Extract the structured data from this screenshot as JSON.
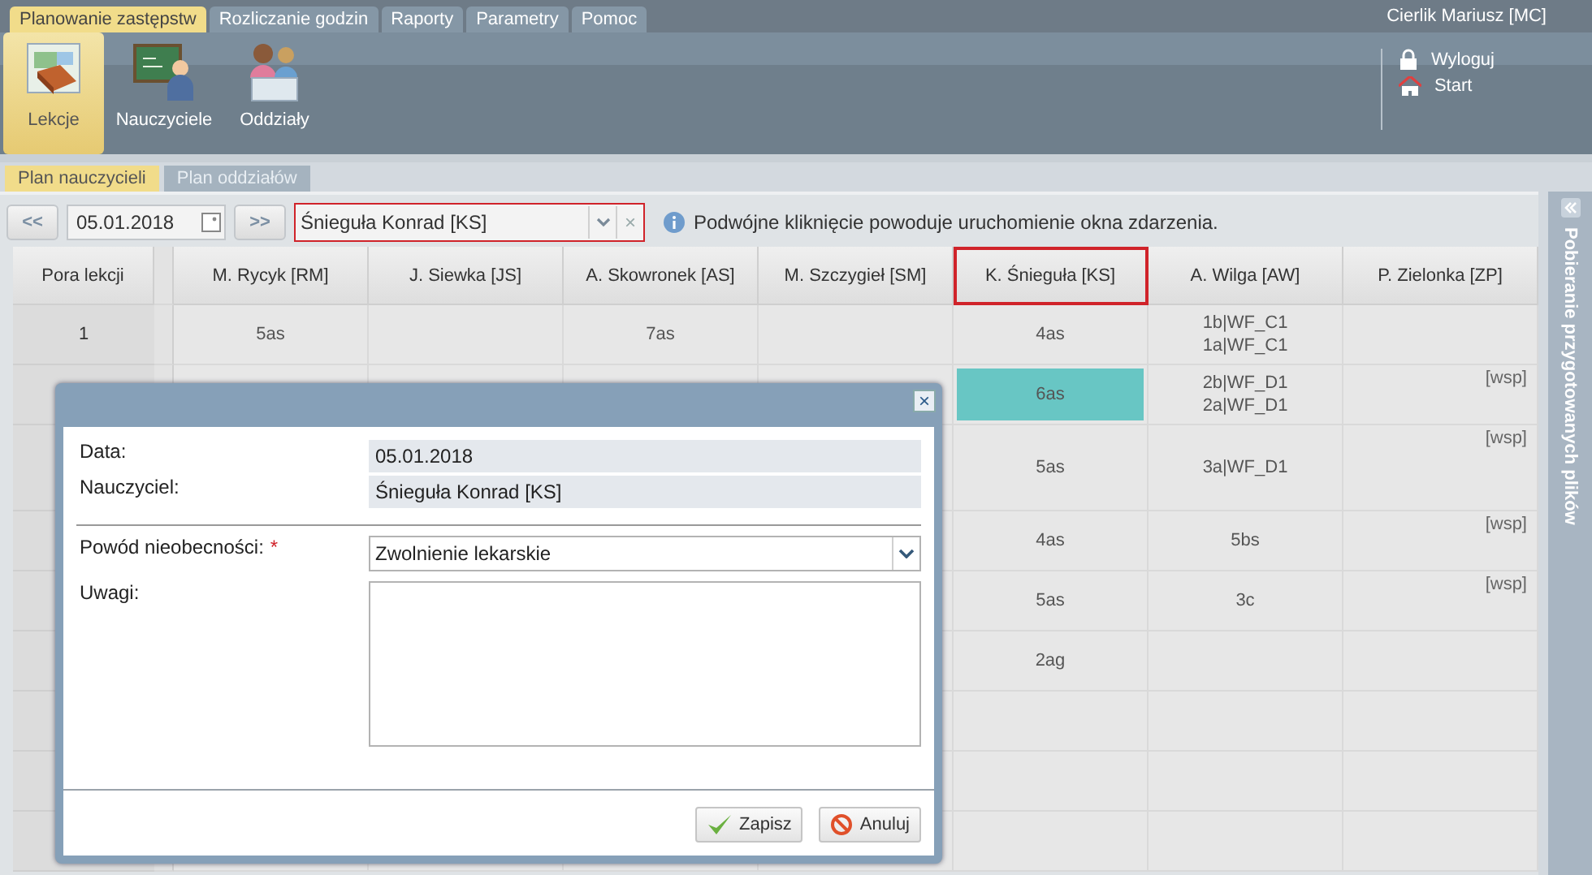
{
  "menu_tabs": [
    {
      "label": "Planowanie zastępstw",
      "selected": true
    },
    {
      "label": "Rozliczanie godzin",
      "selected": false
    },
    {
      "label": "Raporty",
      "selected": false
    },
    {
      "label": "Parametry",
      "selected": false
    },
    {
      "label": "Pomoc",
      "selected": false
    }
  ],
  "user": "Cierlik Mariusz [MC]",
  "ribbon": [
    {
      "label": "Lekcje",
      "kind": "lessons",
      "selected": true
    },
    {
      "label": "Nauczyciele",
      "kind": "teachers",
      "selected": false
    },
    {
      "label": "Oddziały",
      "kind": "classes",
      "selected": false
    }
  ],
  "user_links": [
    {
      "label": "Wyloguj",
      "kind": "logout"
    },
    {
      "label": "Start",
      "kind": "home"
    }
  ],
  "view_tabs": [
    {
      "label": "Plan nauczycieli",
      "selected": true
    },
    {
      "label": "Plan oddziałów",
      "selected": false
    }
  ],
  "toolbar": {
    "prev": "<<",
    "date": "05.01.2018",
    "next": ">>",
    "teacher": "Śnieguła Konrad [KS]",
    "teacher_highlighted": true,
    "clear": "×",
    "hint": "Podwójne kliknięcie powoduje uruchomienie okna zdarzenia."
  },
  "side_panel": {
    "title": "Pobieranie przygotowanych plików"
  },
  "table": {
    "period_header": "Pora lekcji",
    "columns": [
      {
        "label": "M. Rycyk [RM]",
        "selected": false
      },
      {
        "label": "J. Siewka [JS]",
        "selected": false
      },
      {
        "label": "A. Skowronek [AS]",
        "selected": false
      },
      {
        "label": "M. Szczygieł [SM]",
        "selected": false
      },
      {
        "label": "K. Śnieguła [KS]",
        "selected": true
      },
      {
        "label": "A. Wilga [AW]",
        "selected": false
      },
      {
        "label": "P. Zielonka [ZP]",
        "selected": false
      }
    ],
    "rows": [
      {
        "period": "1",
        "cells": [
          {
            "lines": [
              "5as"
            ]
          },
          null,
          {
            "lines": [
              "7as"
            ]
          },
          null,
          {
            "lines": [
              "4as"
            ],
            "selected": false
          },
          {
            "lines": [
              "1b|WF_C1",
              "1a|WF_C1"
            ]
          },
          null
        ]
      },
      {
        "cells": [
          null,
          null,
          null,
          null,
          {
            "lines": [
              "6as"
            ],
            "selected": true
          },
          {
            "lines": [
              "2b|WF_D1",
              "2a|WF_D1"
            ]
          },
          {
            "tag": "[wsp]"
          }
        ]
      },
      {
        "cells": [
          null,
          null,
          null,
          null,
          {
            "lines": [
              "5as"
            ],
            "selected": false
          },
          {
            "lines": [
              "3a|WF_D1"
            ]
          },
          {
            "tag": "[wsp]"
          }
        ],
        "tall": true
      },
      {
        "cells": [
          null,
          null,
          null,
          null,
          {
            "lines": [
              "4as"
            ],
            "selected": false
          },
          {
            "lines": [
              "5bs"
            ]
          },
          {
            "tag": "[wsp]"
          }
        ]
      },
      {
        "cells": [
          null,
          null,
          null,
          null,
          {
            "lines": [
              "5as"
            ],
            "selected": false
          },
          {
            "lines": [
              "3c"
            ]
          },
          {
            "tag": "[wsp]"
          }
        ]
      },
      {
        "cells": [
          null,
          null,
          null,
          null,
          {
            "lines": [
              "2ag"
            ],
            "selected": false
          },
          null,
          null
        ]
      },
      {
        "cells": [
          null,
          null,
          null,
          null,
          null,
          null,
          null
        ]
      },
      {
        "cells": [
          null,
          null,
          null,
          null,
          null,
          null,
          null
        ]
      },
      {
        "cells": [
          null,
          null,
          null,
          null,
          null,
          null,
          null
        ]
      }
    ]
  },
  "dialog": {
    "close": "×",
    "info": [
      {
        "label": "Data:",
        "value": "05.01.2018"
      },
      {
        "label": "Nauczyciel:",
        "value": "Śnieguła Konrad [KS]"
      }
    ],
    "reason": {
      "label": "Powód nieobecności:",
      "required": "*",
      "value": "Zwolnienie lekarskie"
    },
    "notes": {
      "label": "Uwagi:"
    },
    "buttons": [
      {
        "label": "Zapisz",
        "kind": "save"
      },
      {
        "label": "Anuluj",
        "kind": "cancel"
      }
    ]
  }
}
